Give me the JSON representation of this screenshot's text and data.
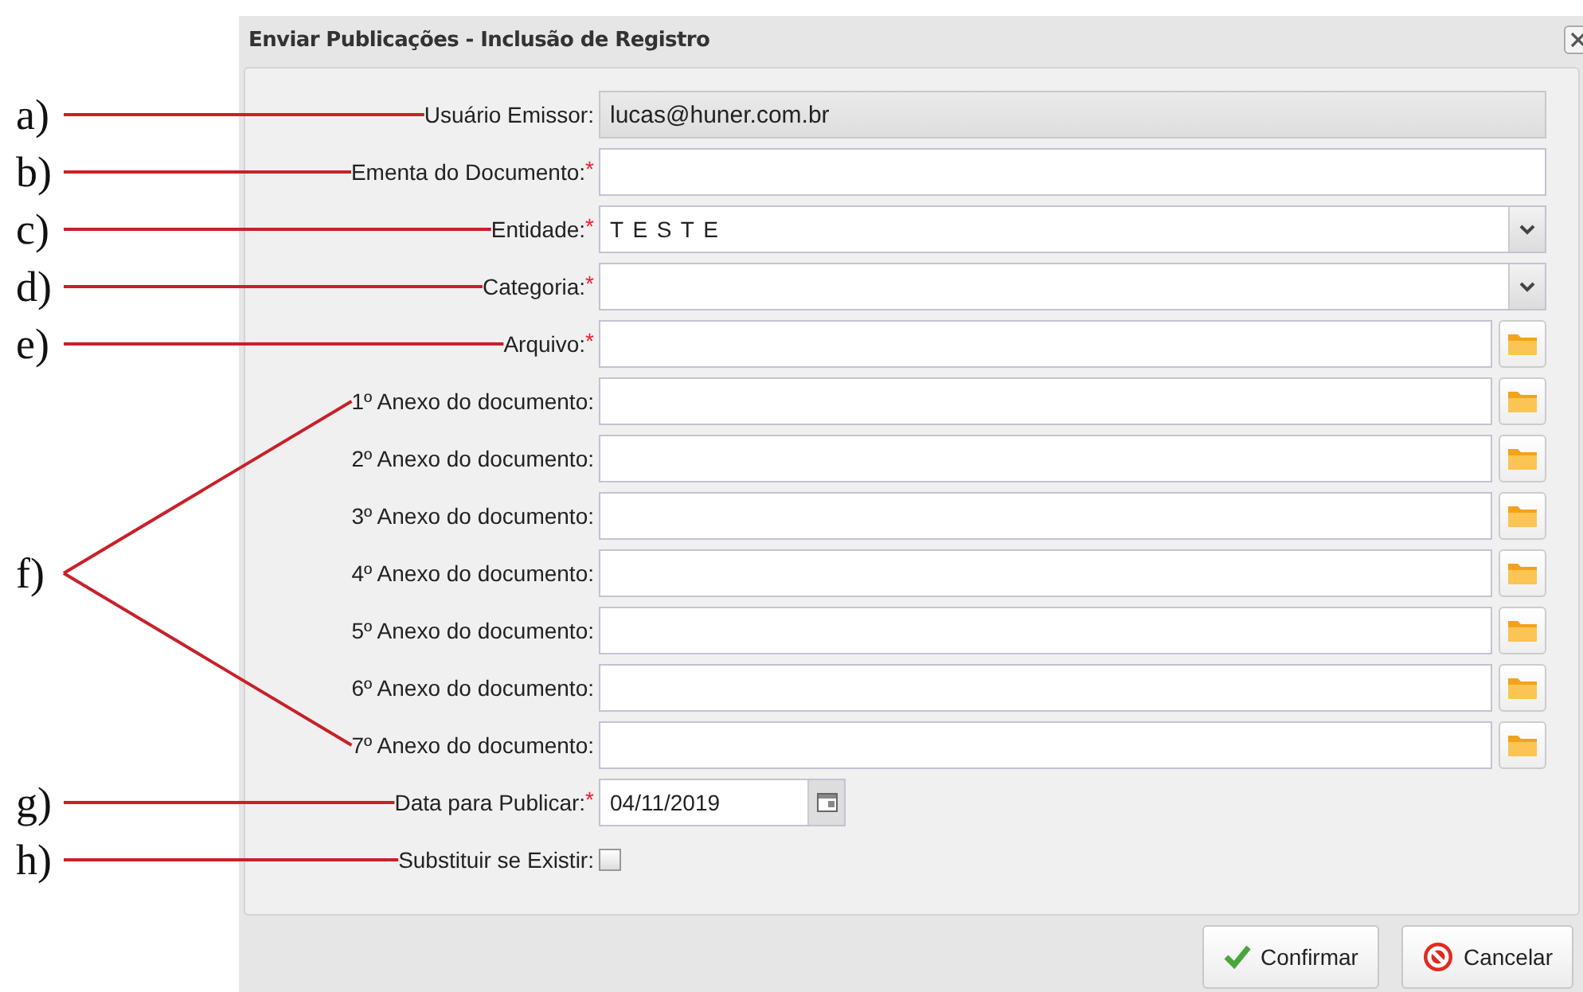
{
  "dialog": {
    "title": "Enviar Publicações - Inclusão de Registro",
    "fields": [
      {
        "kind": "readonly",
        "annotation": "a)",
        "label": "Usuário Emissor:",
        "value": "lucas@huner.com.br"
      },
      {
        "kind": "text",
        "annotation": "b)",
        "label": "Ementa do Documento:",
        "required_mark": "*"
      },
      {
        "kind": "select",
        "annotation": "c)",
        "label": "Entidade:",
        "required_mark": "*",
        "value": "T E S T E"
      },
      {
        "kind": "select",
        "annotation": "d)",
        "label": "Categoria:",
        "required_mark": "*"
      },
      {
        "kind": "file",
        "annotation": "e)",
        "label": "Arquivo:",
        "required_mark": "*"
      },
      {
        "kind": "group",
        "annotation": "f)",
        "children": [
          {
            "kind": "file",
            "label": "1º Anexo do documento:"
          },
          {
            "kind": "file",
            "label": "2º Anexo do documento:"
          },
          {
            "kind": "file",
            "label": "3º Anexo do documento:"
          },
          {
            "kind": "file",
            "label": "4º Anexo do documento:"
          },
          {
            "kind": "file",
            "label": "5º Anexo do documento:"
          },
          {
            "kind": "file",
            "label": "6º Anexo do documento:"
          },
          {
            "kind": "file",
            "label": "7º Anexo do documento:"
          }
        ]
      },
      {
        "kind": "date",
        "annotation": "g)",
        "label": "Data para Publicar:",
        "required_mark": "*",
        "value": "04/11/2019"
      },
      {
        "kind": "checkbox",
        "annotation": "h)",
        "label": "Substituir se Existir:",
        "checked": false
      }
    ],
    "buttons": [
      {
        "kind": "confirm",
        "label": "Confirmar"
      },
      {
        "kind": "cancel",
        "label": "Cancelar"
      }
    ]
  }
}
